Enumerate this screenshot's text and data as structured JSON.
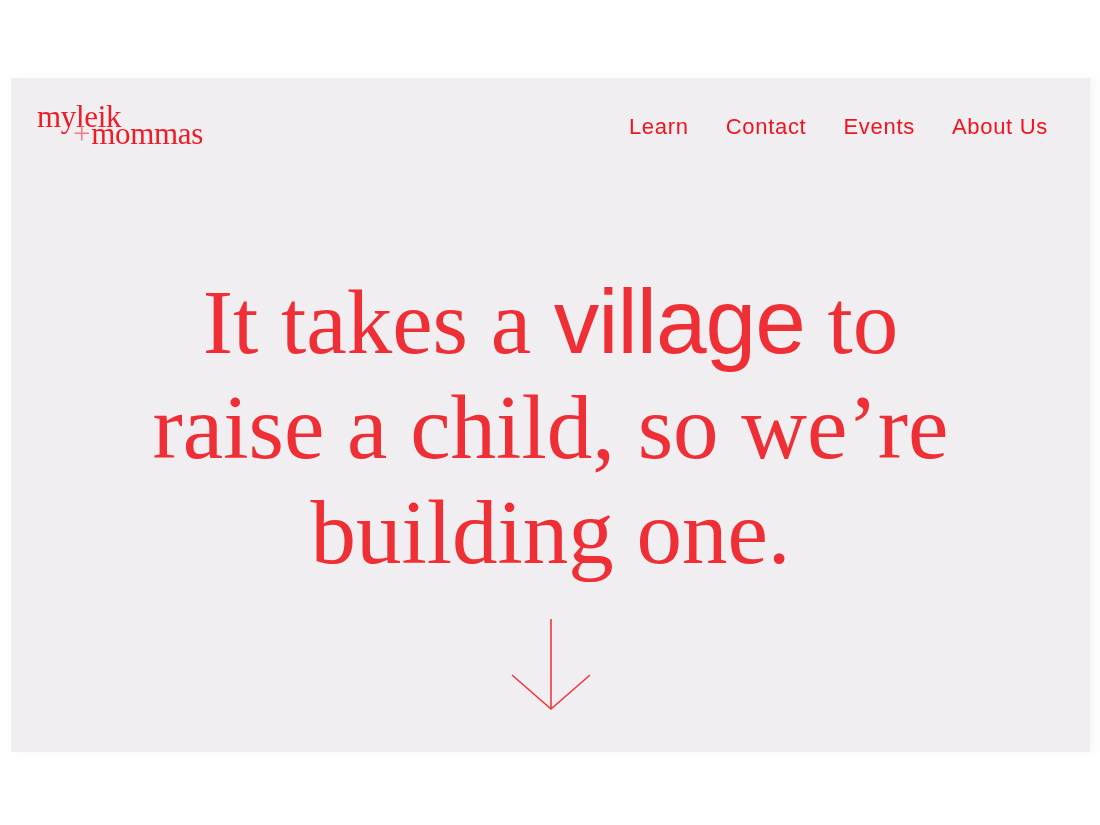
{
  "logo": {
    "first_line": "myleik",
    "joiner": "+",
    "second_line": "mommas"
  },
  "nav_links": [
    {
      "label": "Learn"
    },
    {
      "label": "Contact"
    },
    {
      "label": "Events"
    },
    {
      "label": "About Us"
    }
  ],
  "hero": {
    "headline": [
      {
        "text": "It takes a ",
        "kind": "serif"
      },
      {
        "text": "village",
        "kind": "sans"
      },
      {
        "text": " to raise a child, so we’re building one.",
        "kind": "serif"
      }
    ]
  }
}
